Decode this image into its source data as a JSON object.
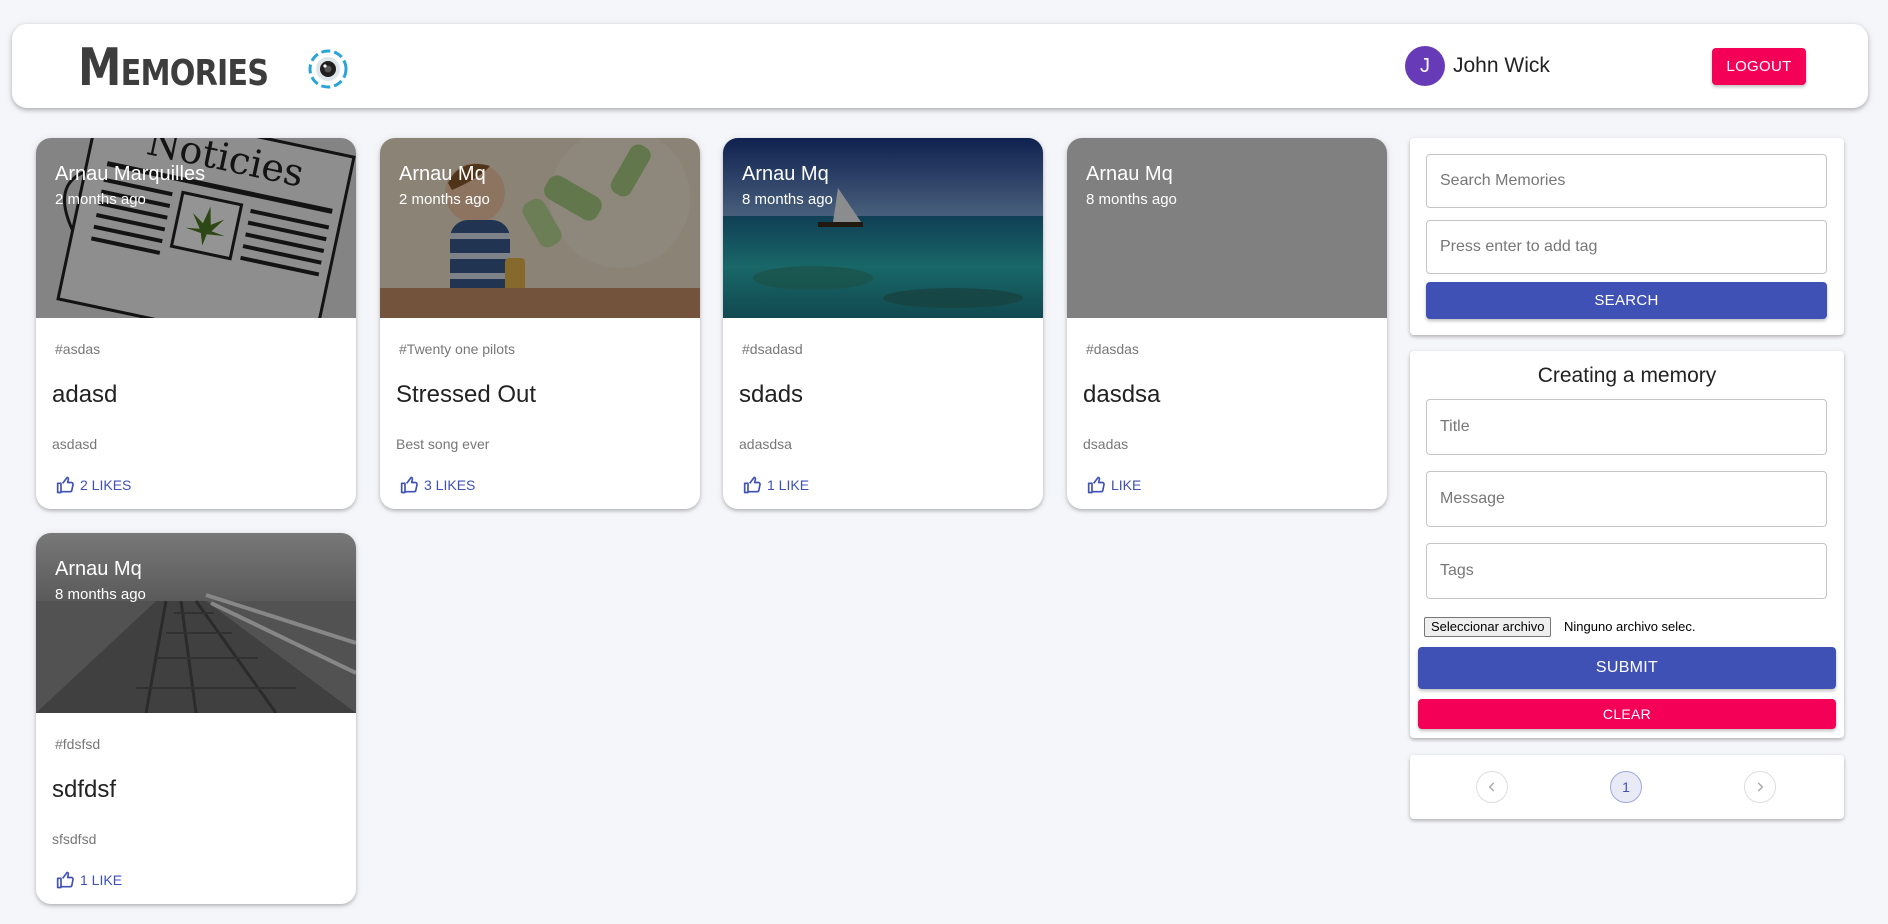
{
  "header": {
    "brand": "Memories",
    "user_initial": "J",
    "user_name": "John Wick",
    "logout_label": "Logout"
  },
  "posts": [
    {
      "creator": "Arnau Marquilles",
      "time": "2 months ago",
      "tags": "#asdas",
      "title": "adasd",
      "message": "asdasd",
      "likes": "2 LIKES",
      "image": "newspaper"
    },
    {
      "creator": "Arnau Mq",
      "time": "2 months ago",
      "tags": "#Twenty one pilots",
      "title": "Stressed Out",
      "message": "Best song ever",
      "likes": "3 LIKES",
      "image": "illustration"
    },
    {
      "creator": "Arnau Mq",
      "time": "8 months ago",
      "tags": "#dsadasd",
      "title": "sdads",
      "message": "adasdsa",
      "likes": "1 LIKE",
      "image": "sea"
    },
    {
      "creator": "Arnau Mq",
      "time": "8 months ago",
      "tags": "#dasdas",
      "title": "dasdsa",
      "message": "dsadas",
      "likes": "LIKE",
      "image": "blank"
    },
    {
      "creator": "Arnau Mq",
      "time": "8 months ago",
      "tags": "#fdsfsd",
      "title": "sdfdsf",
      "message": "sfsdfsd",
      "likes": "1 LIKE",
      "image": "pier"
    }
  ],
  "search": {
    "search_placeholder": "Search Memories",
    "tags_placeholder": "Press enter to add tag",
    "button_label": "Search"
  },
  "form": {
    "heading": "Creating a memory",
    "title_placeholder": "Title",
    "message_placeholder": "Message",
    "tags_placeholder": "Tags",
    "file_button_label": "Seleccionar archivo",
    "file_status": "Ninguno archivo selec.",
    "submit_label": "Submit",
    "clear_label": "Clear"
  },
  "pagination": {
    "prev_icon": "chevron-left-icon",
    "current_page": "1",
    "next_icon": "chevron-right-icon"
  },
  "colors": {
    "primary": "#3f51b5",
    "secondary": "#f50057",
    "avatar": "#673ab7",
    "background": "#f5f6fa"
  }
}
